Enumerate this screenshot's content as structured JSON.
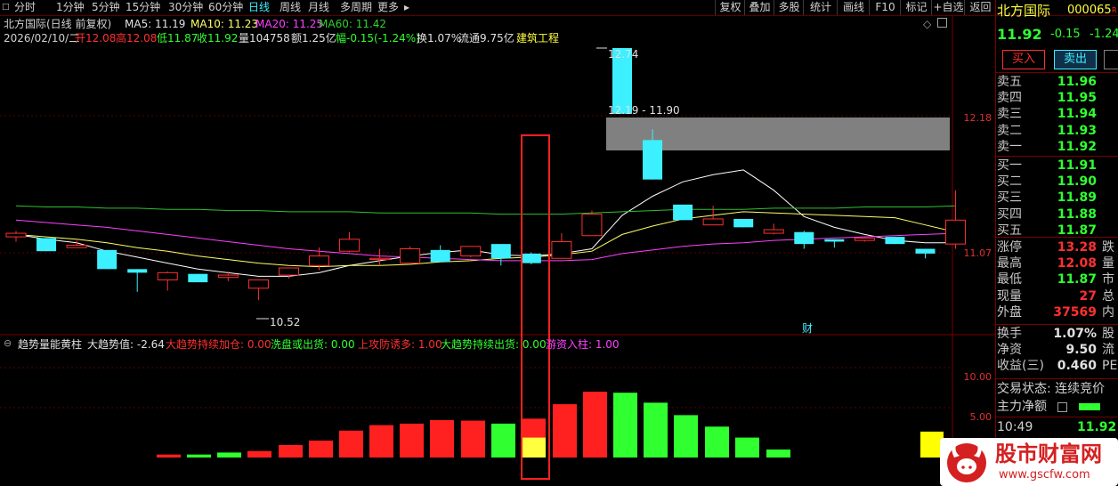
{
  "toolbar": {
    "periods": [
      "分时",
      "1分钟",
      "5分钟",
      "15分钟",
      "30分钟",
      "60分钟",
      "日线",
      "周线",
      "月线",
      "多周期",
      "更多"
    ],
    "active_period": "日线",
    "buttons": [
      "复权",
      "叠加",
      "多股",
      "统计",
      "画线",
      "F10",
      "标记",
      "+自选",
      "返回"
    ]
  },
  "chart_header": {
    "title": "北方国际(日线 前复权)",
    "ma5": "MA5: 11.19",
    "ma10": "MA10: 11.23",
    "ma20": "MA20: 11.25",
    "ma60": "MA60: 11.42",
    "info": {
      "date": "2026/02/10/二",
      "open": "开12.08",
      "high": "高12.08",
      "low": "低11.87",
      "close": "收11.92",
      "volume": "量104758",
      "amount": "额1.25亿",
      "change": "幅-0.15(-1.24%)",
      "turnover": "换1.07%",
      "float": "流通9.75亿",
      "sector": "建筑工程"
    }
  },
  "price_annotations": {
    "high_label": "12.74",
    "range_label": "12.19 - 11.90",
    "low_label": "10.52",
    "cai_marker": "财",
    "ref_price": "12.18",
    "ref_price2": "11.07"
  },
  "indicator": {
    "name": "趋势量能黄柱",
    "trend_value": "大趋势值: -2.64",
    "items": [
      {
        "text": "大趋势持续加仓: 0.00",
        "color": "#ff3030"
      },
      {
        "text": "洗盘或出货: 0.00",
        "color": "#30ff30"
      },
      {
        "text": "上攻防诱多: 1.00",
        "color": "#ff3030"
      },
      {
        "text": "大趋势持续出货: 0.00",
        "color": "#30ff30"
      },
      {
        "text": "游资入柱: 1.00",
        "color": "#ff40ff"
      }
    ],
    "y_labels": [
      "10.00",
      "5.00"
    ]
  },
  "chart_data": {
    "type": "candlestick",
    "candles": [
      {
        "o": 11.16,
        "c": 11.19,
        "h": 11.21,
        "l": 11.12
      },
      {
        "o": 11.15,
        "c": 11.04,
        "h": 11.15,
        "l": 11.04
      },
      {
        "o": 11.07,
        "c": 11.09,
        "h": 11.13,
        "l": 11.07
      },
      {
        "o": 11.05,
        "c": 10.89,
        "h": 11.05,
        "l": 10.89
      },
      {
        "o": 10.89,
        "c": 10.86,
        "h": 10.89,
        "l": 10.7
      },
      {
        "o": 10.8,
        "c": 10.86,
        "h": 10.87,
        "l": 10.71
      },
      {
        "o": 10.85,
        "c": 10.78,
        "h": 10.85,
        "l": 10.78
      },
      {
        "o": 10.82,
        "c": 10.84,
        "h": 10.87,
        "l": 10.79
      },
      {
        "o": 10.73,
        "c": 10.8,
        "h": 10.8,
        "l": 10.63
      },
      {
        "o": 10.84,
        "c": 10.9,
        "h": 10.9,
        "l": 10.81
      },
      {
        "o": 10.92,
        "c": 11.0,
        "h": 11.07,
        "l": 10.88
      },
      {
        "o": 11.04,
        "c": 11.14,
        "h": 11.2,
        "l": 11.03
      },
      {
        "o": 10.97,
        "c": 10.98,
        "h": 11.06,
        "l": 10.92
      },
      {
        "o": 10.94,
        "c": 11.06,
        "h": 11.08,
        "l": 10.94
      },
      {
        "o": 11.05,
        "c": 10.95,
        "h": 11.09,
        "l": 10.95
      },
      {
        "o": 11.0,
        "c": 11.08,
        "h": 11.08,
        "l": 10.99
      },
      {
        "o": 11.1,
        "c": 10.98,
        "h": 11.1,
        "l": 10.92
      },
      {
        "o": 11.02,
        "c": 10.94,
        "h": 11.03,
        "l": 10.93
      },
      {
        "o": 10.98,
        "c": 11.12,
        "h": 11.19,
        "l": 10.98
      },
      {
        "o": 11.17,
        "c": 11.35,
        "h": 11.38,
        "l": 11.17
      },
      {
        "o": 12.74,
        "c": 12.19,
        "h": 12.74,
        "l": 12.19
      },
      {
        "o": 11.97,
        "c": 11.64,
        "h": 12.06,
        "l": 11.64
      },
      {
        "o": 11.43,
        "c": 11.3,
        "h": 11.43,
        "l": 11.3
      },
      {
        "o": 11.26,
        "c": 11.31,
        "h": 11.42,
        "l": 11.26
      },
      {
        "o": 11.31,
        "c": 11.24,
        "h": 11.31,
        "l": 11.24
      },
      {
        "o": 11.19,
        "c": 11.22,
        "h": 11.27,
        "l": 11.18
      },
      {
        "o": 11.2,
        "c": 11.1,
        "h": 11.21,
        "l": 11.06
      },
      {
        "o": 11.14,
        "c": 11.12,
        "h": 11.14,
        "l": 11.07
      },
      {
        "o": 11.13,
        "c": 11.15,
        "h": 11.16,
        "l": 11.12
      },
      {
        "o": 11.16,
        "c": 11.1,
        "h": 11.16,
        "l": 11.1
      },
      {
        "o": 11.06,
        "c": 11.02,
        "h": 11.06,
        "l": 10.98
      },
      {
        "o": 11.1,
        "c": 11.3,
        "h": 11.55,
        "l": 11.06
      }
    ],
    "ma_lines": [
      {
        "name": "MA5",
        "color": "#ffffff",
        "values": [
          11.18,
          11.14,
          11.11,
          11.04,
          10.99,
          10.94,
          10.89,
          10.86,
          10.83,
          10.83,
          10.86,
          10.92,
          10.96,
          11.0,
          11.03,
          11.05,
          11.01,
          11.0,
          11.02,
          11.06,
          11.34,
          11.5,
          11.62,
          11.68,
          11.72,
          11.55,
          11.33,
          11.24,
          11.18,
          11.13,
          11.11,
          11.11
        ]
      },
      {
        "name": "MA10",
        "color": "#ffff66",
        "values": [
          11.18,
          11.16,
          11.14,
          11.11,
          11.07,
          11.04,
          11.0,
          10.97,
          10.94,
          10.92,
          10.91,
          10.92,
          10.92,
          10.93,
          10.95,
          10.96,
          10.98,
          10.99,
          11.01,
          11.04,
          11.18,
          11.25,
          11.31,
          11.34,
          11.37,
          11.36,
          11.35,
          11.34,
          11.33,
          11.32,
          11.26,
          11.2
        ]
      },
      {
        "name": "MA20",
        "color": "#ff40ff",
        "values": [
          11.3,
          11.28,
          11.26,
          11.24,
          11.21,
          11.18,
          11.15,
          11.12,
          11.09,
          11.06,
          11.04,
          11.02,
          11.0,
          10.99,
          10.98,
          10.97,
          10.96,
          10.96,
          10.96,
          10.97,
          11.02,
          11.05,
          11.08,
          11.1,
          11.11,
          11.13,
          11.14,
          11.15,
          11.16,
          11.17,
          11.18,
          11.19
        ]
      },
      {
        "name": "MA60",
        "color": "#30c030",
        "values": [
          11.42,
          11.41,
          11.41,
          11.4,
          11.4,
          11.39,
          11.39,
          11.38,
          11.38,
          11.37,
          11.37,
          11.37,
          11.36,
          11.36,
          11.36,
          11.36,
          11.35,
          11.35,
          11.35,
          11.36,
          11.37,
          11.38,
          11.39,
          11.39,
          11.39,
          11.4,
          11.4,
          11.4,
          11.41,
          11.41,
          11.41,
          11.42
        ]
      }
    ],
    "volume_bars": [
      {
        "v": 0.6,
        "color": "#ff2020"
      },
      {
        "v": 0.6,
        "color": "#30ff30"
      },
      {
        "v": 1.0,
        "color": "#30ff30"
      },
      {
        "v": 1.3,
        "color": "#ff2020"
      },
      {
        "v": 2.5,
        "color": "#ff2020"
      },
      {
        "v": 3.4,
        "color": "#ff2020"
      },
      {
        "v": 5.4,
        "color": "#ff2020"
      },
      {
        "v": 6.5,
        "color": "#ff2020"
      },
      {
        "v": 6.8,
        "color": "#ff2020"
      },
      {
        "v": 7.5,
        "color": "#ff2020"
      },
      {
        "v": 7.4,
        "color": "#ff2020"
      },
      {
        "v": 6.8,
        "color": "#30ff30"
      },
      {
        "v": 7.8,
        "color": "#ff2020",
        "yellow": 4.0
      },
      {
        "v": 10.7,
        "color": "#ff2020"
      },
      {
        "v": 13.2,
        "color": "#ff2020"
      },
      {
        "v": 13.0,
        "color": "#30ff30"
      },
      {
        "v": 11.0,
        "color": "#30ff30"
      },
      {
        "v": 8.5,
        "color": "#30ff30"
      },
      {
        "v": 6.2,
        "color": "#30ff30"
      },
      {
        "v": 4.0,
        "color": "#30ff30"
      },
      {
        "v": 1.6,
        "color": "#30ff30"
      }
    ],
    "last_volume": {
      "v": 5.2,
      "color": "#ffff00"
    }
  },
  "quote": {
    "name": "北方国际",
    "code": "000065",
    "price": "11.92",
    "change": "-0.15",
    "pct": "-1.24%",
    "buy_button": "买入",
    "sell_button": "卖出",
    "asks": [
      {
        "label": "卖五",
        "price": "11.96"
      },
      {
        "label": "卖四",
        "price": "11.95"
      },
      {
        "label": "卖三",
        "price": "11.94"
      },
      {
        "label": "卖二",
        "price": "11.93"
      },
      {
        "label": "卖一",
        "price": "11.92"
      }
    ],
    "bids": [
      {
        "label": "买一",
        "price": "11.91"
      },
      {
        "label": "买二",
        "price": "11.90"
      },
      {
        "label": "买三",
        "price": "11.89"
      },
      {
        "label": "买四",
        "price": "11.88"
      },
      {
        "label": "买五",
        "price": "11.87"
      }
    ],
    "stats": [
      {
        "label": "涨停",
        "value": "13.28",
        "tail": "跌",
        "color": "#ff3030"
      },
      {
        "label": "最高",
        "value": "12.08",
        "tail": "量",
        "color": "#ff3030"
      },
      {
        "label": "最低",
        "value": "11.87",
        "tail": "市",
        "color": "#30ff30"
      },
      {
        "label": "现量",
        "value": "27",
        "tail": "总",
        "color": "#ff3030"
      },
      {
        "label": "外盘",
        "value": "37569",
        "tail": "内",
        "color": "#ff3030"
      }
    ],
    "stats2": [
      {
        "label": "换手",
        "value": "1.07%",
        "tail": "股",
        "color": "#e0e0e0"
      },
      {
        "label": "净资",
        "value": "9.50",
        "tail": "流",
        "color": "#e0e0e0"
      },
      {
        "label": "收益(三)",
        "value": "0.460",
        "tail": "PE",
        "color": "#e0e0e0"
      }
    ],
    "trade_status": "交易状态: 连续竞价",
    "main_flow": "主力净额",
    "tick_time": "10:49",
    "tick_price": "11.92"
  },
  "watermark": {
    "main": "股市财富网",
    "url": "www.gscfw.com"
  }
}
